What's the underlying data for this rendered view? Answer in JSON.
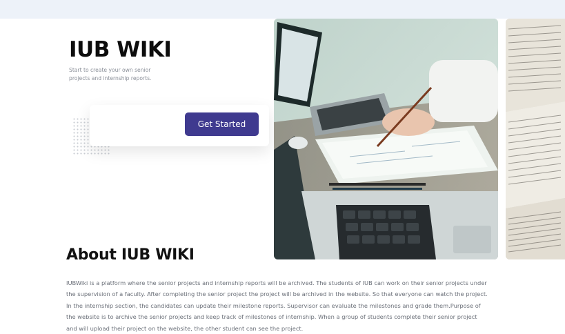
{
  "hero": {
    "title": "IUB WIKI",
    "subtitle": "Start to create your own senior projects and internship reports.",
    "cta_label": "Get Started"
  },
  "about": {
    "title": "About IUB WIKI",
    "text": "IUBWiki is a platform where the senior projects and internship reports will be archived. The students of IUB can work on their senior projects under the supervision of a faculty. After completing the senior project the project will be archived in the website. So that everyone can watch the project. In the internship section, the candidates can update their milestone reports. Supervisor can evaluate the milestones and grade them.Purpose of the website is to archive the senior projects and keep track of milestones of internship. When a group of students complete their senior project and will upload their project on the website, the other student can see the project."
  },
  "colors": {
    "topbar": "#edf2f9",
    "accent": "#3f3a8f",
    "muted_text": "#6a6f78"
  },
  "images": {
    "main": "photo-laptops-desk",
    "side": "photo-book-pages"
  }
}
